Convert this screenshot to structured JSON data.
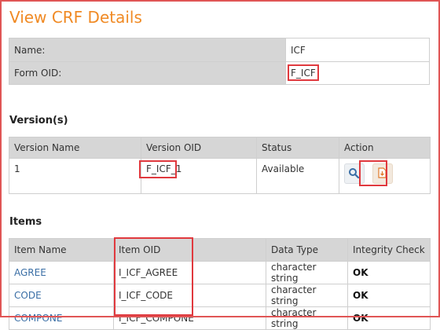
{
  "page": {
    "title": "View CRF Details"
  },
  "info": {
    "rows": [
      {
        "label": "Name:",
        "value": "ICF"
      },
      {
        "label": "Form OID:",
        "value": "F_ICF"
      }
    ]
  },
  "versions": {
    "heading": "Version(s)",
    "columns": [
      "Version Name",
      "Version OID",
      "Status",
      "Action"
    ],
    "rows": [
      {
        "name": "1",
        "oid": "F_ICF_1",
        "status": "Available"
      }
    ],
    "actions": [
      {
        "icon": "magnifier-icon"
      },
      {
        "icon": "download-document-icon"
      }
    ]
  },
  "items": {
    "heading": "Items",
    "columns": [
      "Item Name",
      "Item OID",
      "Data Type",
      "Integrity Check"
    ],
    "rows": [
      {
        "name": "AGREE",
        "oid": "I_ICF_AGREE",
        "type": "character string",
        "check": "OK"
      },
      {
        "name": "CODE",
        "oid": "I_ICF_CODE",
        "type": "character string",
        "check": "OK"
      },
      {
        "name": "COMPONE",
        "oid": "I_ICF_COMPONE",
        "type": "character string",
        "check": "OK"
      }
    ]
  },
  "colors": {
    "title": "#f08a24",
    "link": "#3a6ea5",
    "highlight": "#e0393e",
    "header_bg": "#d6d6d6"
  }
}
